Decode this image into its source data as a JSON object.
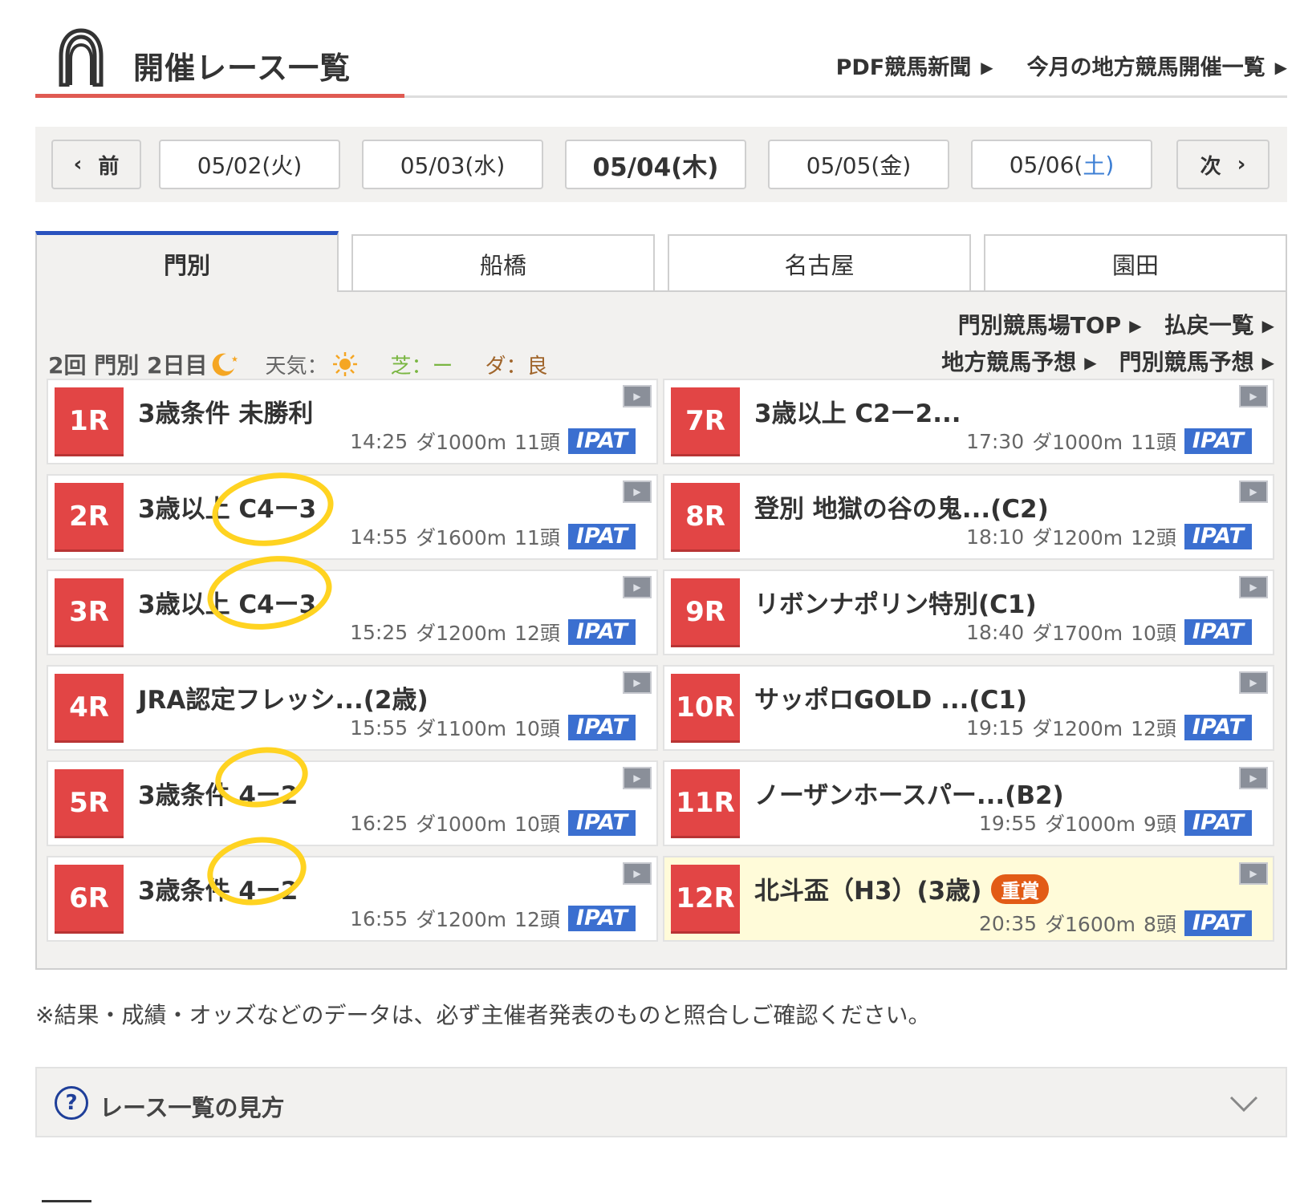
{
  "header": {
    "title": "開催レース一覧",
    "links": [
      {
        "label": "PDF競馬新聞",
        "arrow": "▶"
      },
      {
        "label": "今月の地方競馬開催一覧",
        "arrow": "▶"
      }
    ]
  },
  "datebar": {
    "prev": {
      "label": "前",
      "icon": "‹"
    },
    "next": {
      "label": "次",
      "icon": "›"
    },
    "dates": [
      {
        "label": "05/02(火)"
      },
      {
        "label": "05/03(水)"
      },
      {
        "label": "05/04(木)",
        "selected": true
      },
      {
        "label": "05/05(金)"
      },
      {
        "label": "05/06(",
        "weekday": "土",
        "close": ")"
      }
    ]
  },
  "tabs": [
    {
      "label": "門別",
      "selected": true
    },
    {
      "label": "船橋"
    },
    {
      "label": "名古屋"
    },
    {
      "label": "園田"
    }
  ],
  "panel": {
    "links_row1": [
      {
        "label": "門別競馬場TOP",
        "arrow": "▶"
      },
      {
        "label": "払戻一覧",
        "arrow": "▶"
      }
    ],
    "links_row2": [
      {
        "label": "地方競馬予想",
        "arrow": "▶"
      },
      {
        "label": "門別競馬予想",
        "arrow": "▶"
      }
    ],
    "meeting": {
      "name": "2回 門別 2日目",
      "weather_label": "天気：",
      "turf": "芝：ー",
      "dirt": "ダ：良"
    }
  },
  "races": [
    {
      "num": "1R",
      "name": "3歳条件 未勝利",
      "time": "14:25",
      "course": "ダ1000m",
      "heads": "11頭",
      "ipat": "IPAT"
    },
    {
      "num": "2R",
      "name": "3歳以上 C4ー3",
      "time": "14:55",
      "course": "ダ1600m",
      "heads": "11頭",
      "ipat": "IPAT"
    },
    {
      "num": "3R",
      "name": "3歳以上 C4ー3",
      "time": "15:25",
      "course": "ダ1200m",
      "heads": "12頭",
      "ipat": "IPAT"
    },
    {
      "num": "4R",
      "name": "JRA認定フレッシ...(2歳)",
      "time": "15:55",
      "course": "ダ1100m",
      "heads": "10頭",
      "ipat": "IPAT"
    },
    {
      "num": "5R",
      "name": "3歳条件 4ー2",
      "time": "16:25",
      "course": "ダ1000m",
      "heads": "10頭",
      "ipat": "IPAT"
    },
    {
      "num": "6R",
      "name": "3歳条件 4ー2",
      "time": "16:55",
      "course": "ダ1200m",
      "heads": "12頭",
      "ipat": "IPAT"
    },
    {
      "num": "7R",
      "name": "3歳以上 C2ー2...",
      "time": "17:30",
      "course": "ダ1000m",
      "heads": "11頭",
      "ipat": "IPAT"
    },
    {
      "num": "8R",
      "name": "登別 地獄の谷の鬼...(C2)",
      "time": "18:10",
      "course": "ダ1200m",
      "heads": "12頭",
      "ipat": "IPAT"
    },
    {
      "num": "9R",
      "name": "リボンナポリン特別(C1)",
      "time": "18:40",
      "course": "ダ1700m",
      "heads": "10頭",
      "ipat": "IPAT"
    },
    {
      "num": "10R",
      "name": "サッポロGOLD ...(C1)",
      "time": "19:15",
      "course": "ダ1200m",
      "heads": "12頭",
      "ipat": "IPAT"
    },
    {
      "num": "11R",
      "name": "ノーザンホースパー...(B2)",
      "time": "19:55",
      "course": "ダ1000m",
      "heads": "9頭",
      "ipat": "IPAT"
    },
    {
      "num": "12R",
      "name": "北斗盃（H3）(3歳)",
      "badge": "重賞",
      "time": "20:35",
      "course": "ダ1600m",
      "heads": "8頭",
      "ipat": "IPAT"
    }
  ],
  "notice": "※結果・成績・オッズなどのデータは、必ず主催者発表のものと照合しご確認ください。",
  "howto": {
    "icon": "?",
    "label": "レース一覧の見方"
  },
  "colors": {
    "race_number_bg": "#e24545",
    "ipat_bg": "#3b6fd0",
    "active_tab_border": "#2a52be",
    "header_accent": "#e05a52",
    "grade_badge": "#e25b16",
    "highlight_marker": "#ffd321"
  }
}
